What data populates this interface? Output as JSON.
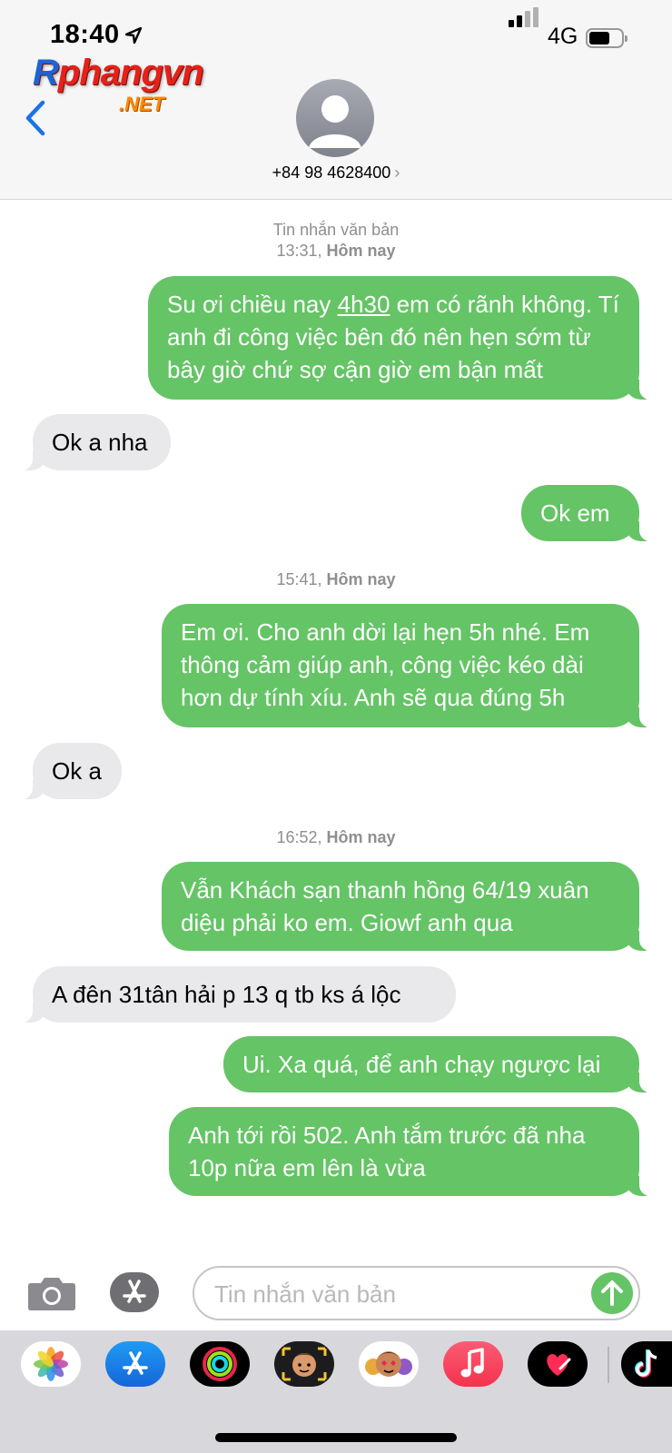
{
  "status_bar": {
    "time": "18:40",
    "network": "4G"
  },
  "watermark": {
    "line1": "Rphangvn",
    "line2": ".NET"
  },
  "header": {
    "contact": "+84 98 4628400"
  },
  "thread": {
    "stamp1_type": "Tin nhắn văn bản",
    "stamp1_time": "13:31,",
    "stamp1_day": "Hôm nay",
    "msg1_pre": "Su ơi chiều nay ",
    "msg1_link": "4h30",
    "msg1_post": " em có rãnh không. Tí anh đi công việc bên đó nên hẹn sớm từ bây giờ chứ sợ cận giờ em bận mất",
    "msg2": "Ok a nha",
    "msg3": "Ok em",
    "stamp2_time": "15:41,",
    "stamp2_day": "Hôm nay",
    "msg4": "Em ơi. Cho anh dời lại hẹn 5h nhé. Em thông cảm giúp anh, công việc kéo dài hơn dự tính xíu. Anh sẽ qua đúng 5h",
    "msg5": "Ok a",
    "stamp3_time": "16:52,",
    "stamp3_day": "Hôm nay",
    "msg6": "Vẫn Khách sạn thanh hồng 64/19 xuân diệu phải ko em. Giowf anh qua",
    "msg7": "A đên 31tân hải p 13 q tb ks á lộc",
    "msg8": "Ui. Xa quá, để anh chạy ngược lại",
    "msg9": "Anh tới rồi 502. Anh tắm trước đã nha 10p nữa em lên là vừa"
  },
  "composer": {
    "placeholder": "Tin nhắn văn bản",
    "value": ""
  },
  "app_drawer": {
    "apps": [
      "photos-icon",
      "app-store-icon",
      "activity-icon",
      "memoji-icon",
      "animoji-icon",
      "music-icon",
      "digital-touch-icon",
      "tiktok-icon"
    ]
  },
  "colors": {
    "outgoing": "#65c466",
    "incoming": "#e9e9eb",
    "accent": "#1a73e8"
  }
}
